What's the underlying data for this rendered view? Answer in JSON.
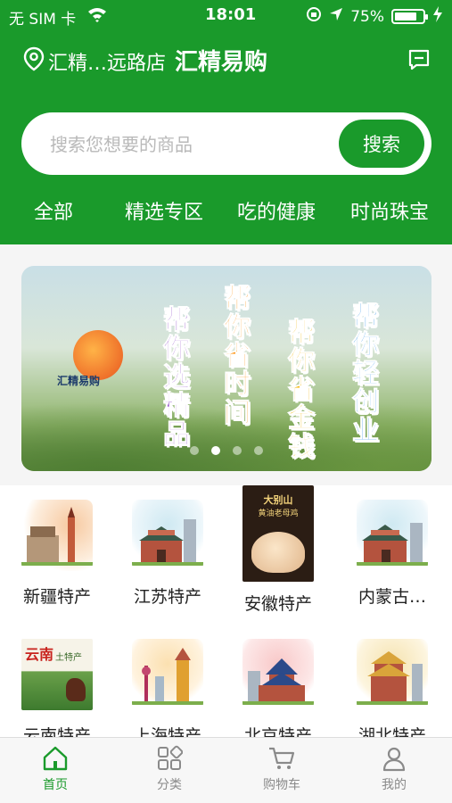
{
  "status_bar": {
    "carrier": "无 SIM 卡",
    "time": "18:01",
    "battery": "75%"
  },
  "nav": {
    "location": "汇精…远路店",
    "title": "汇精易购"
  },
  "search": {
    "placeholder": "搜索您想要的商品",
    "button": "搜索"
  },
  "tabs": [
    "全部",
    "精选专区",
    "吃的健康",
    "时尚珠宝"
  ],
  "banner": {
    "logo_text": "汇精易购",
    "slogans": [
      {
        "text": "帮你选精品",
        "color": "#7b2cbf"
      },
      {
        "text": "帮你省时间",
        "color": "#ff8c00"
      },
      {
        "text": "帮你省金钱",
        "color": "#f4b400"
      },
      {
        "text": "帮你轻创业",
        "color": "#1e88e5"
      }
    ],
    "page_count": 4,
    "active_page": 1
  },
  "categories": [
    {
      "label": "新疆特产"
    },
    {
      "label": "江苏特产"
    },
    {
      "label": "安徽特产",
      "badge_lines": [
        "大别山",
        "黄油老母鸡"
      ]
    },
    {
      "label": "内蒙古…"
    },
    {
      "label": "云南特产",
      "badge_lines": [
        "云南",
        "土特产"
      ]
    },
    {
      "label": "上海特产"
    },
    {
      "label": "北京特产"
    },
    {
      "label": "湖北特产"
    }
  ],
  "tabbar": [
    {
      "label": "首页",
      "icon": "home-icon",
      "active": true
    },
    {
      "label": "分类",
      "icon": "category-icon",
      "active": false
    },
    {
      "label": "购物车",
      "icon": "cart-icon",
      "active": false
    },
    {
      "label": "我的",
      "icon": "user-icon",
      "active": false
    }
  ],
  "colors": {
    "brand": "#1a9a2b",
    "tab_inactive": "#8a8a8a"
  }
}
